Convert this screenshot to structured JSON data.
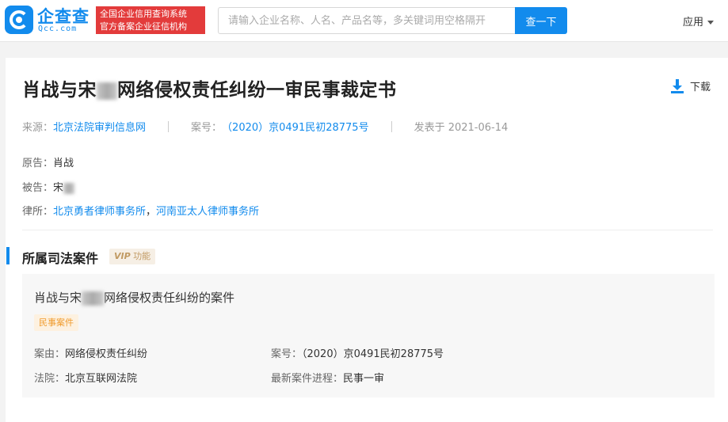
{
  "header": {
    "logo_cn": "企查查",
    "logo_en": "Qcc.com",
    "badge_line1": "全国企业信用查询系统",
    "badge_line2": "官方备案企业征信机构",
    "search_placeholder": "请输入企业名称、人名、产品名等，多关键词用空格隔开",
    "search_button": "查一下",
    "app_menu": "应用"
  },
  "document": {
    "title_prefix": "肖战与宋",
    "title_suffix": "网络侵权责任纠纷一审民事裁定书",
    "download_label": "下载",
    "source_label": "来源：",
    "source_value": "北京法院审判信息网",
    "case_no_label": "案号：",
    "case_no_value": "（2020）京0491民初28775号",
    "published": "发表于 2021-06-14",
    "plaintiff_label": "原告：",
    "plaintiff_value": "肖战",
    "defendant_label": "被告：",
    "defendant_value": "宋",
    "lawyer_label": "律所：",
    "lawyer_1": "北京勇者律师事务所",
    "lawyer_sep": "，",
    "lawyer_2": "河南亚太人律师事务所"
  },
  "judicial_section": {
    "title": "所属司法案件",
    "vip_badge": "VIP",
    "vip_text": "功能",
    "case": {
      "title_prefix": "肖战与宋",
      "title_suffix": "网络侵权责任纠纷的案件",
      "tag": "民事案件",
      "cause_label": "案由：",
      "cause_value": "网络侵权责任纠纷",
      "case_no_label": "案号：",
      "case_no_value": "（2020）京0491民初28775号",
      "court_label": "法院：",
      "court_value": "北京互联网法院",
      "progress_label": "最新案件进程：",
      "progress_value": "民事一审"
    }
  },
  "colors": {
    "brand": "#128bed",
    "badge_red": "#e33b3b",
    "tag_orange": "#f09a2b",
    "vip_gold": "#c19a63"
  }
}
